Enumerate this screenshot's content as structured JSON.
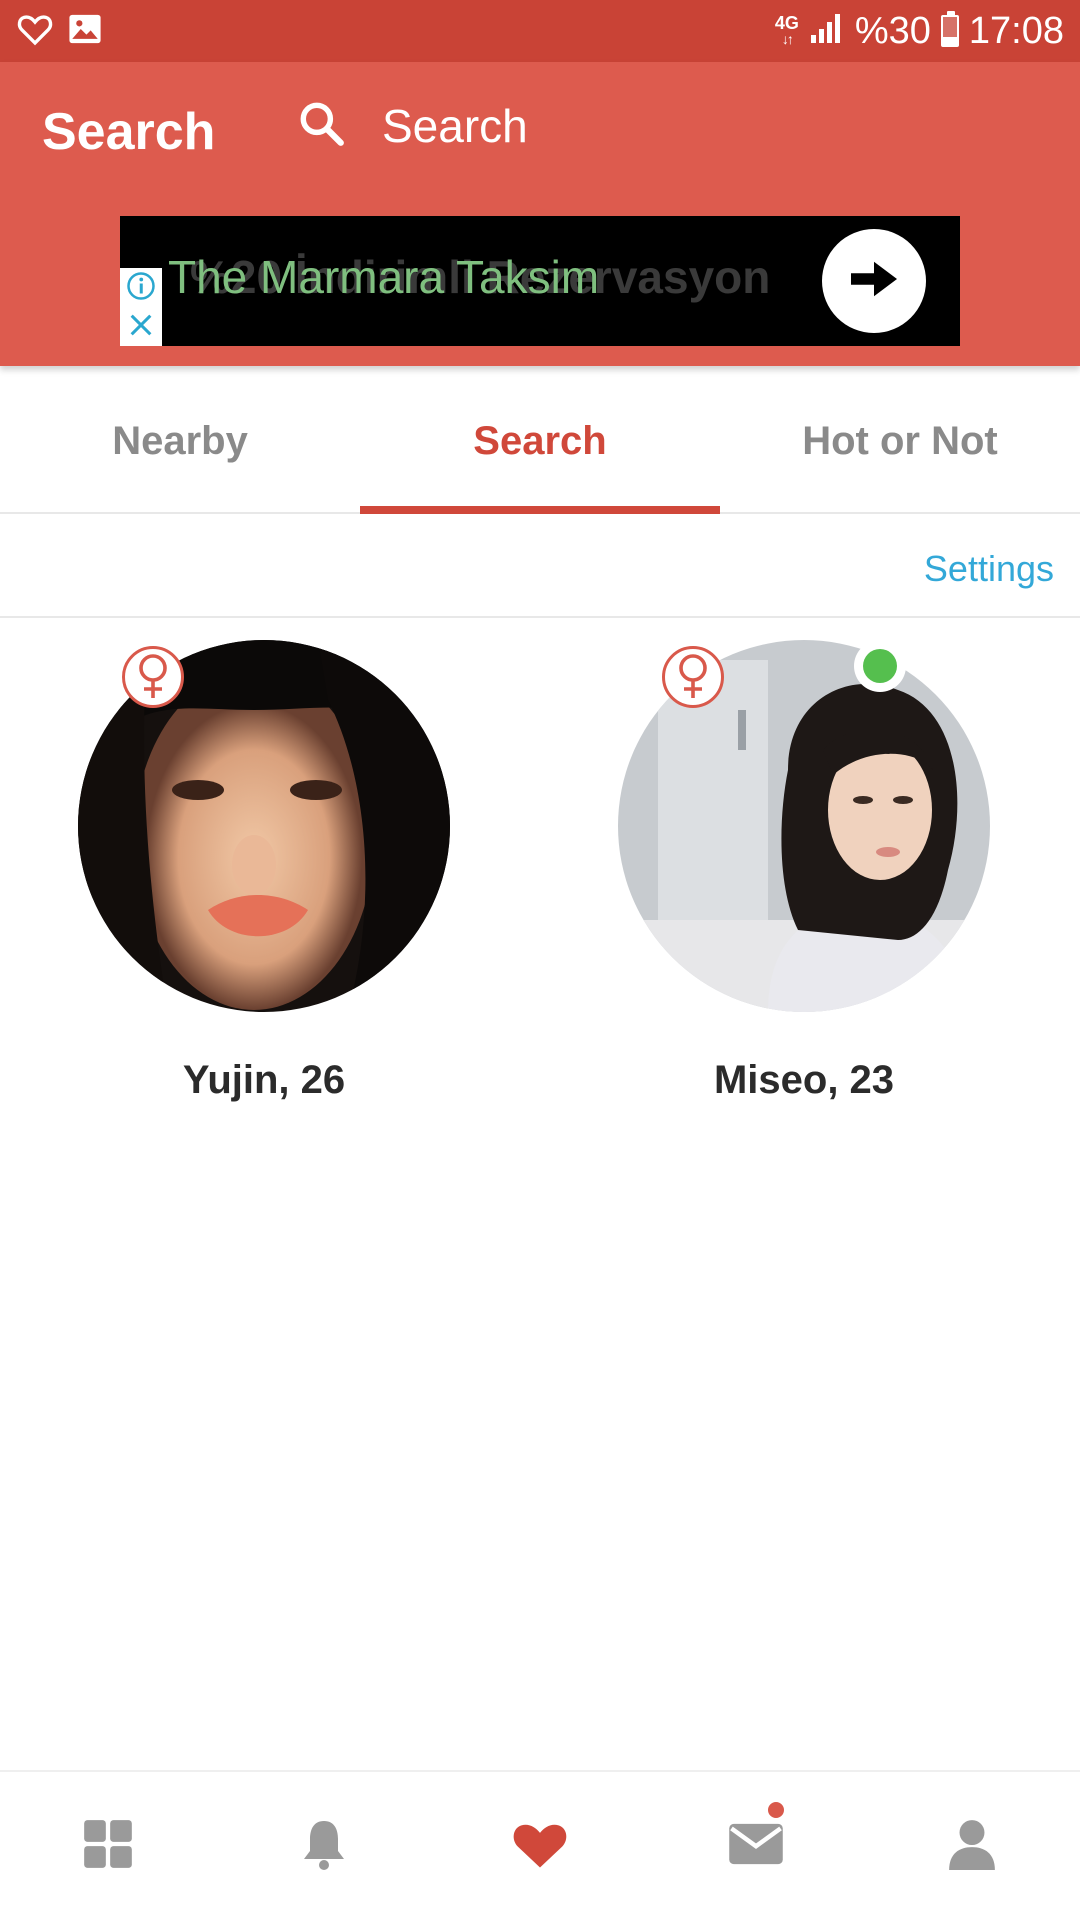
{
  "status_bar": {
    "network": "4G",
    "battery_label": "%30",
    "battery_level": 0.3,
    "time": "17:08"
  },
  "header": {
    "title": "Search",
    "search_placeholder": "Search"
  },
  "ad": {
    "headline": "The Marmara Taksim",
    "ghost_text": "%20 İndirimli Rezervasyon"
  },
  "tabs": [
    {
      "label": "Nearby",
      "active": false
    },
    {
      "label": "Search",
      "active": true
    },
    {
      "label": "Hot or Not",
      "active": false
    }
  ],
  "settings_label": "Settings",
  "profiles": [
    {
      "name_age": "Yujin, 26",
      "gender": "female",
      "online": false
    },
    {
      "name_age": "Miseo, 23",
      "gender": "female",
      "online": true
    }
  ],
  "bottom_nav": [
    {
      "icon": "grid-icon",
      "active": false
    },
    {
      "icon": "bell-icon",
      "active": false
    },
    {
      "icon": "heart-icon",
      "active": true
    },
    {
      "icon": "mail-icon",
      "active": false,
      "badge": true
    },
    {
      "icon": "person-icon",
      "active": false
    }
  ],
  "colors": {
    "status_bar": "#c94336",
    "header": "#dd5b4e",
    "accent": "#d0483a",
    "link": "#33a8d8",
    "online": "#55bf4e",
    "nav_inactive": "#9a9a9a"
  }
}
